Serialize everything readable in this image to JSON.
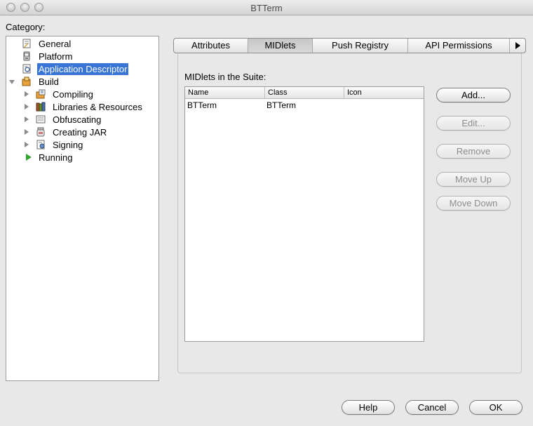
{
  "window": {
    "title": "BTTerm"
  },
  "category": {
    "label": "Category:",
    "items": [
      {
        "label": "General",
        "icon": "general-doc-icon"
      },
      {
        "label": "Platform",
        "icon": "platform-device-icon"
      },
      {
        "label": "Application Descriptor",
        "icon": "descriptor-icon",
        "selected": true
      },
      {
        "label": "Build",
        "icon": "build-icon",
        "expanded": true
      },
      {
        "label": "Compiling",
        "icon": "compiling-icon"
      },
      {
        "label": "Libraries & Resources",
        "icon": "libraries-icon"
      },
      {
        "label": "Obfuscating",
        "icon": "obfuscating-icon"
      },
      {
        "label": "Creating JAR",
        "icon": "jar-icon"
      },
      {
        "label": "Signing",
        "icon": "signing-icon"
      },
      {
        "label": "Running",
        "icon": "run-icon"
      }
    ]
  },
  "tabs": [
    {
      "label": "Attributes"
    },
    {
      "label": "MIDlets",
      "active": true
    },
    {
      "label": "Push Registry"
    },
    {
      "label": "API Permissions"
    }
  ],
  "midlets": {
    "label": "MIDlets in the Suite:",
    "columns": [
      "Name",
      "Class",
      "Icon"
    ],
    "rows": [
      {
        "name": "BTTerm",
        "class": "BTTerm",
        "icon": ""
      }
    ]
  },
  "side_buttons": {
    "add": "Add...",
    "edit": "Edit...",
    "remove": "Remove",
    "move_up": "Move Up",
    "move_down": "Move Down"
  },
  "dialog_buttons": {
    "help": "Help",
    "cancel": "Cancel",
    "ok": "OK"
  },
  "colors": {
    "selection": "#3875d7",
    "run_icon": "#2ea52e"
  }
}
